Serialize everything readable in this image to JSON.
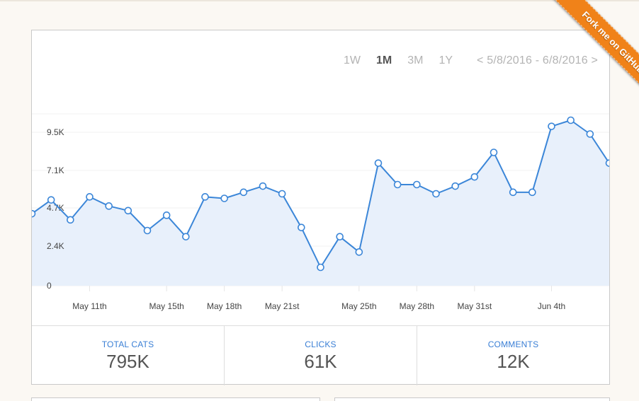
{
  "ribbon": {
    "label": "Fork me on GitHub"
  },
  "range": {
    "options": [
      "1W",
      "1M",
      "3M",
      "1Y"
    ],
    "active": "1M",
    "date_range": "< 5/8/2016 - 6/8/2016 >"
  },
  "chart_data": {
    "type": "area",
    "y_ticks": [
      "0",
      "2.4K",
      "4.7K",
      "7.1K",
      "9.5K"
    ],
    "ylim": [
      0,
      12000
    ],
    "x_tick_labels": [
      {
        "label": "May 11th",
        "day": 3
      },
      {
        "label": "May 15th",
        "day": 7
      },
      {
        "label": "May 18th",
        "day": 10
      },
      {
        "label": "May 21st",
        "day": 13
      },
      {
        "label": "May 25th",
        "day": 17
      },
      {
        "label": "May 28th",
        "day": 20
      },
      {
        "label": "May 31st",
        "day": 23
      },
      {
        "label": "Jun 4th",
        "day": 27
      }
    ],
    "series": [
      {
        "values": [
          4700,
          5600,
          4300,
          5800,
          5200,
          4900,
          3600,
          4600,
          3200,
          5800,
          5700,
          6100,
          6500,
          6000,
          3800,
          1200,
          3200,
          2200,
          8000,
          6600,
          6600,
          6000,
          6500,
          7100,
          8700,
          6100,
          6100,
          10400,
          10800,
          9900,
          8000
        ]
      }
    ],
    "line_color": "#3b86d8",
    "fill_color": "#e8f0fb",
    "grid": true
  },
  "stats": [
    {
      "label": "TOTAL CATS",
      "value": "795K"
    },
    {
      "label": "CLICKS",
      "value": "61K"
    },
    {
      "label": "COMMENTS",
      "value": "12K"
    }
  ]
}
